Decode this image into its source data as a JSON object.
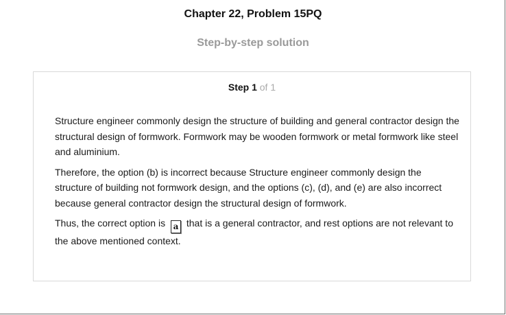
{
  "header": {
    "chapter_title": "Chapter 22, Problem 15PQ",
    "subtitle": "Step-by-step solution"
  },
  "step": {
    "label": "Step 1",
    "of": "of 1"
  },
  "solution": {
    "paragraph1": "Structure engineer commonly design the structure of building and general contractor design the structural design of formwork. Formwork may be wooden formwork or metal formwork like steel and aluminium.",
    "paragraph2": "Therefore, the option (b) is incorrect because Structure engineer commonly design the structure of building not formwork design, and the options (c), (d), and (e) are also incorrect because general contractor design the structural design of formwork.",
    "paragraph3_before": "Thus, the correct option is",
    "answer": "a",
    "paragraph3_after": "that is a general contractor, and rest options are not relevant to the above mentioned context."
  }
}
